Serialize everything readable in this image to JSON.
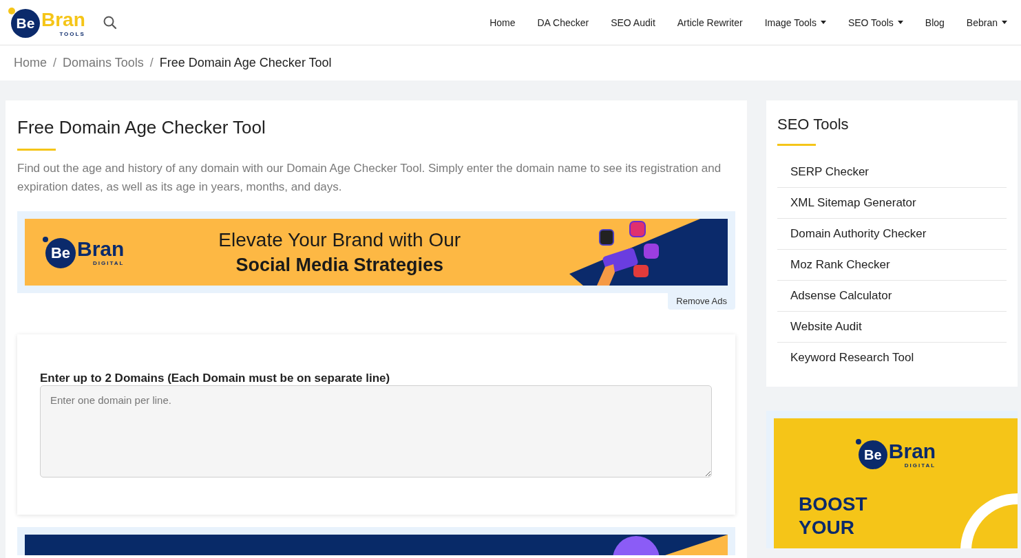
{
  "header": {
    "logo": {
      "be": "Be",
      "bran": "Bran",
      "sub": "TOOLS"
    },
    "nav": [
      {
        "label": "Home",
        "dropdown": false
      },
      {
        "label": "DA Checker",
        "dropdown": false
      },
      {
        "label": "SEO Audit",
        "dropdown": false
      },
      {
        "label": "Article Rewriter",
        "dropdown": false
      },
      {
        "label": "Image Tools",
        "dropdown": true
      },
      {
        "label": "SEO Tools",
        "dropdown": true
      },
      {
        "label": "Blog",
        "dropdown": false
      },
      {
        "label": "Bebran",
        "dropdown": true
      }
    ]
  },
  "breadcrumb": {
    "separator": "/",
    "items": [
      "Home",
      "Domains Tools",
      "Free Domain Age Checker Tool"
    ]
  },
  "main": {
    "title": "Free Domain Age Checker Tool",
    "description": "Find out the age and history of any domain with our Domain Age Checker Tool. Simply enter the domain name to see its registration and expiration dates, as well as its age in years, months, and days.",
    "top_ad": {
      "logo": {
        "be": "Be",
        "bran": "Bran",
        "sub": "DIGITAL"
      },
      "line1": "Elevate Your Brand with Our",
      "line2": "Social Media Strategies",
      "remove_label": "Remove Ads"
    },
    "form": {
      "label": "Enter up to 2 Domains (Each Domain must be on separate line)",
      "placeholder": "Enter one domain per line."
    }
  },
  "sidebar": {
    "title": "SEO Tools",
    "items": [
      "SERP Checker",
      "XML Sitemap Generator",
      "Domain Authority Checker",
      "Moz Rank Checker",
      "Adsense Calculator",
      "Website Audit",
      "Keyword Research Tool"
    ]
  },
  "side_ad": {
    "logo": {
      "be": "Be",
      "bran": "Bran",
      "sub": "DIGITAL"
    },
    "headline": [
      "BOOST",
      "YOUR"
    ]
  }
}
